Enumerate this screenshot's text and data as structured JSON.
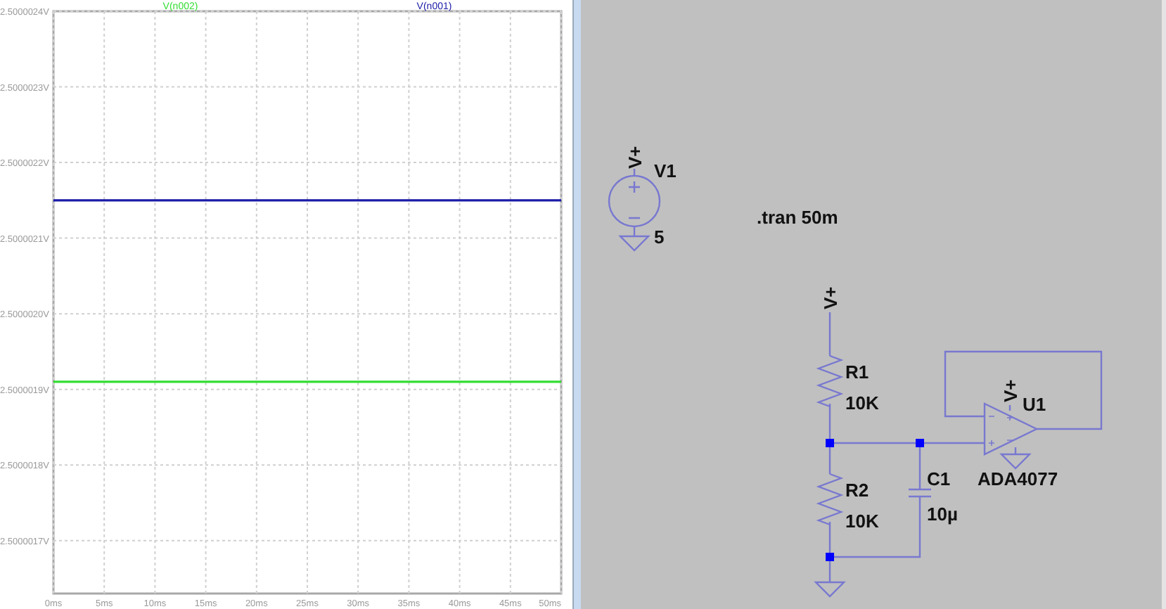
{
  "waveform_plot": {
    "chart_data": {
      "type": "line",
      "grid": true,
      "x": [
        0,
        50
      ],
      "xlim": [
        0,
        50
      ],
      "ylim": [
        2.50000163,
        2.5000024
      ],
      "series": [
        {
          "name": "V(n002)",
          "color": "#33dd33",
          "values": [
            2.50000191,
            2.50000191
          ]
        },
        {
          "name": "V(n001)",
          "color": "#1a1aa8",
          "values": [
            2.50000215,
            2.50000215
          ]
        }
      ],
      "xticks": [
        {
          "value": 0,
          "label": "0ms"
        },
        {
          "value": 5,
          "label": "5ms"
        },
        {
          "value": 10,
          "label": "10ms"
        },
        {
          "value": 15,
          "label": "15ms"
        },
        {
          "value": 20,
          "label": "20ms"
        },
        {
          "value": 25,
          "label": "25ms"
        },
        {
          "value": 30,
          "label": "30ms"
        },
        {
          "value": 35,
          "label": "35ms"
        },
        {
          "value": 40,
          "label": "40ms"
        },
        {
          "value": 45,
          "label": "45ms"
        },
        {
          "value": 50,
          "label": "50ms"
        }
      ],
      "yticks": [
        {
          "value": 2.5000017,
          "label": "2.5000017V"
        },
        {
          "value": 2.5000018,
          "label": "2.5000018V"
        },
        {
          "value": 2.5000019,
          "label": "2.5000019V"
        },
        {
          "value": 2.500002,
          "label": "2.5000020V"
        },
        {
          "value": 2.5000021,
          "label": "2.5000021V"
        },
        {
          "value": 2.5000022,
          "label": "2.5000022V"
        },
        {
          "value": 2.5000023,
          "label": "2.5000023V"
        },
        {
          "value": 2.5000024,
          "label": "2.5000024V"
        }
      ]
    }
  },
  "schematic": {
    "directive": ".tran 50m",
    "components": [
      {
        "kind": "voltage_source",
        "name": "V1",
        "value": "5"
      },
      {
        "kind": "resistor",
        "name": "R1",
        "value": "10K"
      },
      {
        "kind": "resistor",
        "name": "R2",
        "value": "10K"
      },
      {
        "kind": "capacitor",
        "name": "C1",
        "value": "10µ"
      },
      {
        "kind": "opamp",
        "name": "U1",
        "value": "ADA4077"
      }
    ],
    "net_labels": [
      "V+",
      "V+",
      "V+"
    ]
  }
}
